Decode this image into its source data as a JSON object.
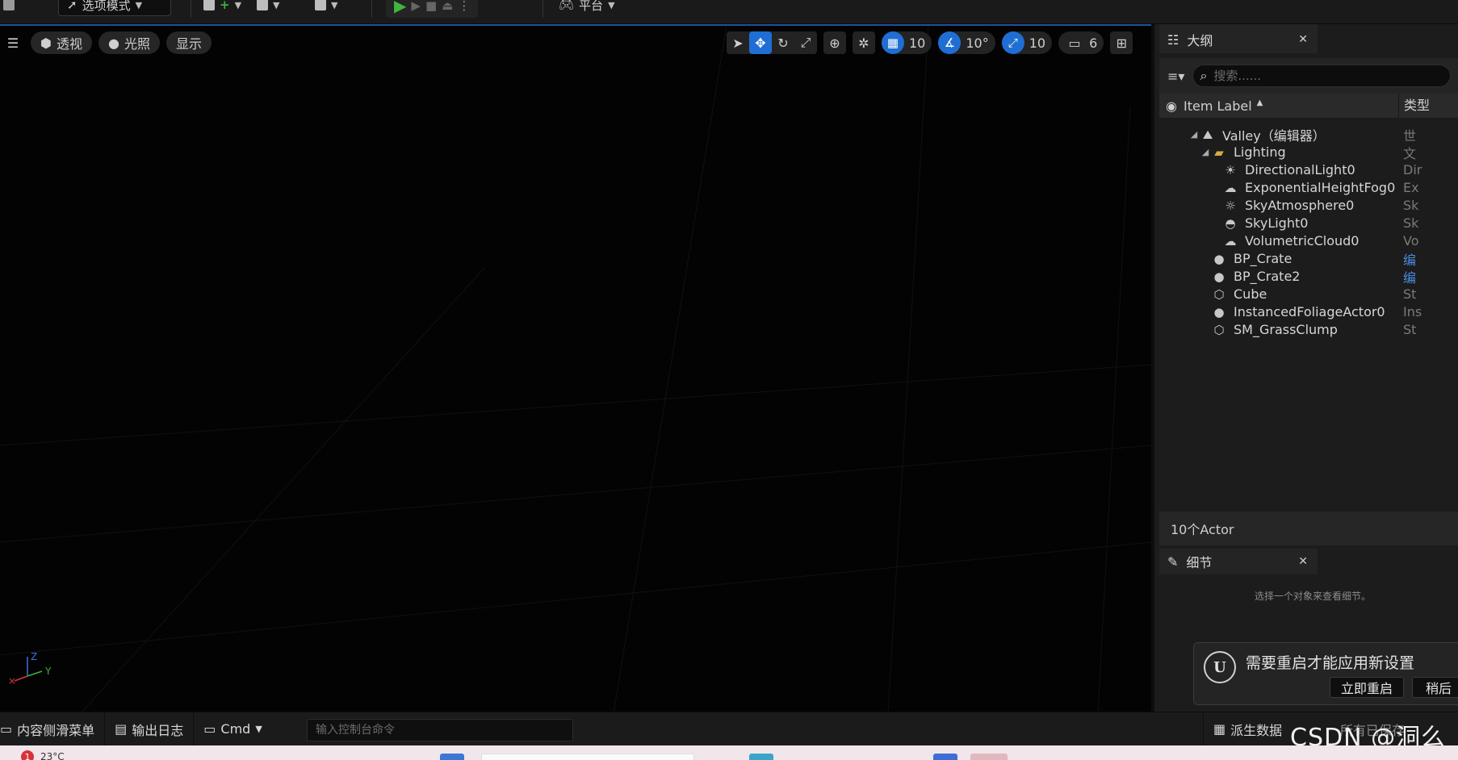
{
  "toolbar": {
    "mode_label": "选项模式",
    "platform_label": "平台"
  },
  "viewport": {
    "perspective_label": "透视",
    "lighting_label": "光照",
    "show_label": "显示",
    "grid_snap_value": "10",
    "rotation_snap_value": "10°",
    "scale_snap_value": "10",
    "camera_speed_value": "6",
    "axis_z": "Z",
    "axis_y": "Y"
  },
  "outliner": {
    "tab_title": "大纲",
    "search_placeholder": "搜索......",
    "column_label": "Item Label",
    "column_type": "类型",
    "rows": [
      {
        "label": "Valley（编辑器）",
        "type": "世"
      },
      {
        "label": "Lighting",
        "type": "文"
      },
      {
        "label": "DirectionalLight0",
        "type": "Dir"
      },
      {
        "label": "ExponentialHeightFog0",
        "type": "Ex"
      },
      {
        "label": "SkyAtmosphere0",
        "type": "Sk"
      },
      {
        "label": "SkyLight0",
        "type": "Sk"
      },
      {
        "label": "VolumetricCloud0",
        "type": "Vo"
      },
      {
        "label": "BP_Crate",
        "type": "编"
      },
      {
        "label": "BP_Crate2",
        "type": "编"
      },
      {
        "label": "Cube",
        "type": "St"
      },
      {
        "label": "InstancedFoliageActor0",
        "type": "Ins"
      },
      {
        "label": "SM_GrassClump",
        "type": "St"
      }
    ],
    "actor_count": "10个Actor"
  },
  "details": {
    "tab_title": "细节",
    "empty_message": "选择一个对象来查看细节。"
  },
  "notification": {
    "logo_text": "U",
    "message": "需要重启才能应用新设置",
    "restart_now_label": "立即重启",
    "later_label": "稍后"
  },
  "bottom_bar": {
    "content_drawer_label": "内容侧滑菜单",
    "output_log_label": "输出日志",
    "cmd_label": "Cmd",
    "console_placeholder": "输入控制台命令",
    "derived_data_label": "派生数据",
    "source_control_label": "所有已保存"
  },
  "watermark": "CSDN @洞么",
  "taskbar": {
    "badge": "1",
    "temperature": "23°C"
  },
  "colors": {
    "accent_blue": "#1f6ed4",
    "panel_bg": "#1c1c1c",
    "viewport_bg": "#030303"
  }
}
